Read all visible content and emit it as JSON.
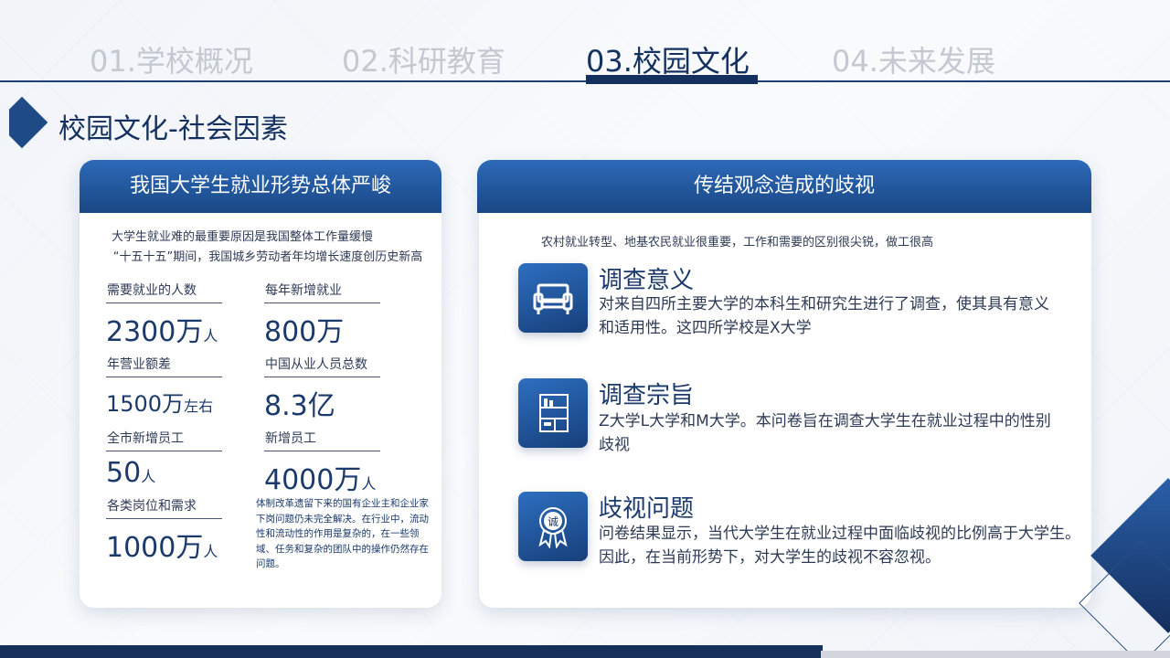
{
  "nav": {
    "tabs": [
      {
        "label": "01.学校概况"
      },
      {
        "label": "02.科研教育"
      },
      {
        "label": "03.校园文化"
      },
      {
        "label": "04.未来发展"
      }
    ],
    "active_index": 2
  },
  "section": {
    "title": "校园文化-社会因素"
  },
  "left_card": {
    "header": "我国大学生就业形势总体严峻",
    "intro_line1": "大学生就业难的最重要原因是我国整体工作量缓慢",
    "intro_line2": "“十五十五”期间，我国城乡劳动者年均增长速度创历史新高",
    "stats": [
      {
        "label": "需要就业的人数",
        "value": "2300万",
        "unit": "人"
      },
      {
        "label": "每年新增就业",
        "value": "800万",
        "unit": ""
      },
      {
        "label": "年营业额差",
        "value": "1500万",
        "unit": "左右"
      },
      {
        "label": "中国从业人员总数",
        "value": "8.3亿",
        "unit": ""
      },
      {
        "label": "全市新增员工",
        "value": "50",
        "unit": "人"
      },
      {
        "label": "新增员工",
        "value": "4000万",
        "unit": "人"
      },
      {
        "label": "各类岗位和需求",
        "value": "1000万",
        "unit": "人"
      }
    ],
    "note": "体制改革遗留下来的国有企业主和企业家下岗问题仍未完全解决。在行业中，流动性和流动性的作用是复杂的，在一些领域、任务和复杂的团队中的操作仍然存在问题。"
  },
  "right_card": {
    "header": "传结观念造成的歧视",
    "intro": "农村就业转型、地基农民就业很重要，工作和需要的区别很尖锐，做工很高",
    "items": [
      {
        "title": "调查意义",
        "desc": "对来自四所主要大学的本科生和研究生进行了调查，使其具有意义和适用性。这四所学校是X大学",
        "icon": "sofa-icon"
      },
      {
        "title": "调查宗旨",
        "desc": "Z大学L大学和M大学。本问卷旨在调查大学生在就业过程中的性别歧视",
        "icon": "bookshelf-icon"
      },
      {
        "title": "歧视问题",
        "desc": "问卷结果显示，当代大学生在就业过程中面临歧视的比例高于大学生。因此，在当前形势下，对大学生的歧视不容忽视。",
        "icon": "badge-icon"
      }
    ],
    "badge_char": "诚"
  },
  "colors": {
    "primary": "#14305e",
    "accent": "#2c6ab8",
    "inactive_tab": "#c4c8d0"
  }
}
